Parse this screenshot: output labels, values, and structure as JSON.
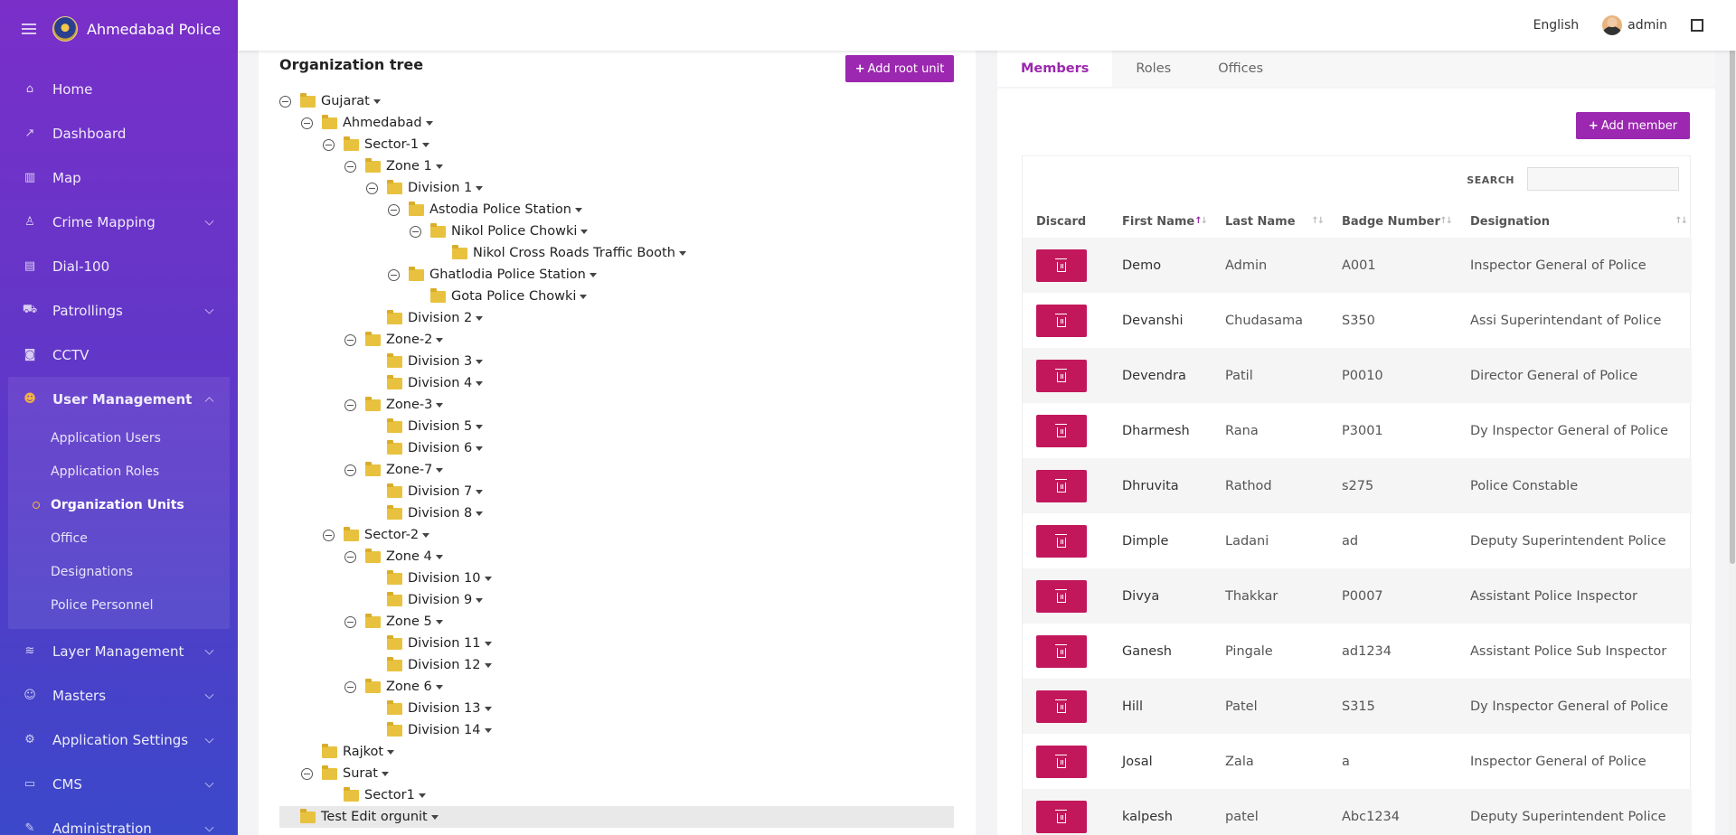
{
  "app": {
    "title": "Ahmedabad Police"
  },
  "topbar": {
    "language": "English",
    "user": "admin"
  },
  "sidebar": {
    "items": [
      {
        "label": "Home",
        "icon": "home-icon"
      },
      {
        "label": "Dashboard",
        "icon": "chart-line-icon"
      },
      {
        "label": "Map",
        "icon": "map-icon"
      },
      {
        "label": "Crime Mapping",
        "icon": "walk-icon"
      },
      {
        "label": "Dial-100",
        "icon": "document-icon"
      },
      {
        "label": "Patrollings",
        "icon": "car-icon"
      },
      {
        "label": "CCTV",
        "icon": "camera-icon"
      }
    ],
    "user_management": {
      "label": "User Management",
      "sub": [
        "Application Users",
        "Application Roles",
        "Organization Units",
        "Office",
        "Designations",
        "Police Personnel"
      ],
      "active": "Organization Units"
    },
    "items_after": [
      {
        "label": "Layer Management",
        "icon": "layers-icon"
      },
      {
        "label": "Masters",
        "icon": "users-icon"
      },
      {
        "label": "Application Settings",
        "icon": "cogs-icon"
      },
      {
        "label": "CMS",
        "icon": "card-icon"
      },
      {
        "label": "Administration",
        "icon": "wrench-icon"
      }
    ]
  },
  "tree": {
    "title": "Organization tree",
    "add_root_label": "Add root unit",
    "nodes": [
      {
        "label": "Gujarat",
        "depth": 0,
        "toggle": true
      },
      {
        "label": "Ahmedabad",
        "depth": 1,
        "toggle": true
      },
      {
        "label": "Sector-1",
        "depth": 2,
        "toggle": true
      },
      {
        "label": "Zone 1",
        "depth": 3,
        "toggle": true
      },
      {
        "label": "Division 1",
        "depth": 4,
        "toggle": true
      },
      {
        "label": "Astodia Police Station",
        "depth": 5,
        "toggle": true
      },
      {
        "label": "Nikol Police Chowki",
        "depth": 6,
        "toggle": true
      },
      {
        "label": "Nikol Cross Roads Traffic Booth",
        "depth": 7,
        "toggle": false
      },
      {
        "label": "Ghatlodia Police Station",
        "depth": 5,
        "toggle": true
      },
      {
        "label": "Gota Police Chowki",
        "depth": 6,
        "toggle": false
      },
      {
        "label": "Division 2",
        "depth": 4,
        "toggle": false
      },
      {
        "label": "Zone-2",
        "depth": 3,
        "toggle": true
      },
      {
        "label": "Division 3",
        "depth": 4,
        "toggle": false
      },
      {
        "label": "Division 4",
        "depth": 4,
        "toggle": false
      },
      {
        "label": "Zone-3",
        "depth": 3,
        "toggle": true
      },
      {
        "label": "Division 5",
        "depth": 4,
        "toggle": false
      },
      {
        "label": "Division 6",
        "depth": 4,
        "toggle": false
      },
      {
        "label": "Zone-7",
        "depth": 3,
        "toggle": true
      },
      {
        "label": "Division 7",
        "depth": 4,
        "toggle": false
      },
      {
        "label": "Division 8",
        "depth": 4,
        "toggle": false
      },
      {
        "label": "Sector-2",
        "depth": 2,
        "toggle": true
      },
      {
        "label": "Zone 4",
        "depth": 3,
        "toggle": true
      },
      {
        "label": "Division 10",
        "depth": 4,
        "toggle": false
      },
      {
        "label": "Division 9",
        "depth": 4,
        "toggle": false
      },
      {
        "label": "Zone 5",
        "depth": 3,
        "toggle": true
      },
      {
        "label": "Division 11",
        "depth": 4,
        "toggle": false
      },
      {
        "label": "Division 12",
        "depth": 4,
        "toggle": false
      },
      {
        "label": "Zone 6",
        "depth": 3,
        "toggle": true
      },
      {
        "label": "Division 13",
        "depth": 4,
        "toggle": false
      },
      {
        "label": "Division 14",
        "depth": 4,
        "toggle": false
      },
      {
        "label": "Rajkot",
        "depth": 1,
        "toggle": false
      },
      {
        "label": "Surat",
        "depth": 1,
        "toggle": true
      },
      {
        "label": "Sector1",
        "depth": 2,
        "toggle": false
      },
      {
        "label": "Test Edit orgunit",
        "depth": 0,
        "toggle": false,
        "selected": true
      }
    ]
  },
  "members": {
    "tabs": [
      "Members",
      "Roles",
      "Offices"
    ],
    "active_tab": "Members",
    "add_label": "Add member",
    "search_label": "SEARCH",
    "columns": [
      "Discard",
      "First Name",
      "Last Name",
      "Badge Number",
      "Designation"
    ],
    "rows": [
      [
        "Demo",
        "Admin",
        "A001",
        "Inspector General of Police"
      ],
      [
        "Devanshi",
        "Chudasama",
        "S350",
        "Assi Superintendant of Police"
      ],
      [
        "Devendra",
        "Patil",
        "P0010",
        "Director General of Police"
      ],
      [
        "Dharmesh",
        "Rana",
        "P3001",
        "Dy Inspector General of Police"
      ],
      [
        "Dhruvita",
        "Rathod",
        "s275",
        "Police Constable"
      ],
      [
        "Dimple",
        "Ladani",
        "ad",
        "Deputy Superintendent Police"
      ],
      [
        "Divya",
        "Thakkar",
        "P0007",
        "Assistant Police Inspector"
      ],
      [
        "Ganesh",
        "Pingale",
        "ad1234",
        "Assistant Police Sub Inspector"
      ],
      [
        "Hill",
        "Patel",
        "S315",
        "Dy Inspector General of Police"
      ],
      [
        "Josal",
        "Zala",
        "a",
        "Inspector General of Police"
      ],
      [
        "kalpesh",
        "patel",
        "Abc1234",
        "Deputy Superintendent Police"
      ]
    ]
  },
  "colors": {
    "accent": "#9c27b0",
    "danger": "#c2185b",
    "sidebar_top": "#7a2fc9",
    "sidebar_bottom": "#3b48c9",
    "folder": "#e8c23f"
  }
}
